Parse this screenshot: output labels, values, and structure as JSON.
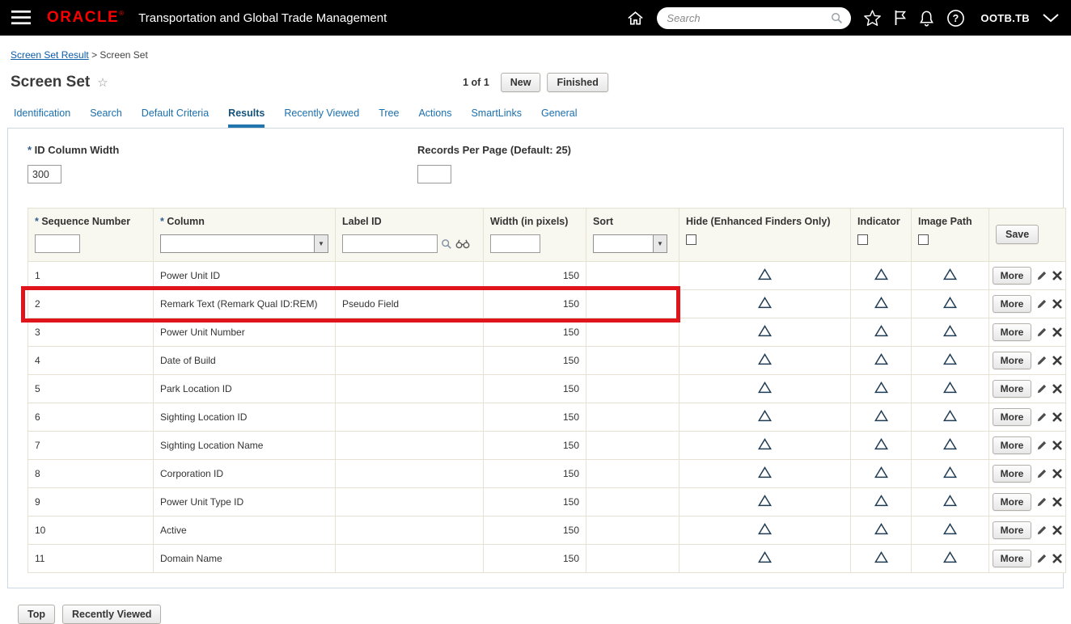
{
  "header": {
    "brand": "ORACLE",
    "brand_reg": "®",
    "app_title": "Transportation and Global Trade Management",
    "search_placeholder": "Search",
    "username": "OOTB.TB"
  },
  "breadcrumb": {
    "link": "Screen Set Result",
    "separator": ">",
    "current": "Screen Set"
  },
  "page": {
    "title": "Screen Set",
    "pager": "1 of 1",
    "new_button": "New",
    "finished_button": "Finished"
  },
  "tabs": [
    {
      "label": "Identification",
      "active": false
    },
    {
      "label": "Search",
      "active": false
    },
    {
      "label": "Default Criteria",
      "active": false
    },
    {
      "label": "Results",
      "active": true
    },
    {
      "label": "Recently Viewed",
      "active": false
    },
    {
      "label": "Tree",
      "active": false
    },
    {
      "label": "Actions",
      "active": false
    },
    {
      "label": "SmartLinks",
      "active": false
    },
    {
      "label": "General",
      "active": false
    }
  ],
  "form": {
    "id_column_width_label": "ID Column Width",
    "id_column_width_value": "300",
    "records_per_page_label": "Records Per Page (Default: 25)",
    "records_per_page_value": ""
  },
  "results_table": {
    "headers": {
      "sequence_number": "Sequence Number",
      "column": "Column",
      "label_id": "Label ID",
      "width": "Width (in pixels)",
      "sort": "Sort",
      "hide": "Hide (Enhanced Finders Only)",
      "indicator": "Indicator",
      "image_path": "Image Path"
    },
    "save_button": "Save",
    "more_button": "More",
    "rows": [
      {
        "seq": "1",
        "column": "Power Unit ID",
        "label_id": "",
        "width": "150",
        "sort": "",
        "highlighted": false
      },
      {
        "seq": "2",
        "column": "Remark Text (Remark Qual ID:REM)",
        "label_id": "Pseudo Field",
        "width": "150",
        "sort": "",
        "highlighted": true
      },
      {
        "seq": "3",
        "column": "Power Unit Number",
        "label_id": "",
        "width": "150",
        "sort": "",
        "highlighted": false
      },
      {
        "seq": "4",
        "column": "Date of Build",
        "label_id": "",
        "width": "150",
        "sort": "",
        "highlighted": false
      },
      {
        "seq": "5",
        "column": "Park Location ID",
        "label_id": "",
        "width": "150",
        "sort": "",
        "highlighted": false
      },
      {
        "seq": "6",
        "column": "Sighting Location ID",
        "label_id": "",
        "width": "150",
        "sort": "",
        "highlighted": false
      },
      {
        "seq": "7",
        "column": "Sighting Location Name",
        "label_id": "",
        "width": "150",
        "sort": "",
        "highlighted": false
      },
      {
        "seq": "8",
        "column": "Corporation ID",
        "label_id": "",
        "width": "150",
        "sort": "",
        "highlighted": false
      },
      {
        "seq": "9",
        "column": "Power Unit Type ID",
        "label_id": "",
        "width": "150",
        "sort": "",
        "highlighted": false
      },
      {
        "seq": "10",
        "column": "Active",
        "label_id": "",
        "width": "150",
        "sort": "",
        "highlighted": false
      },
      {
        "seq": "11",
        "column": "Domain Name",
        "label_id": "",
        "width": "150",
        "sort": "",
        "highlighted": false
      }
    ]
  },
  "footer": {
    "top_button": "Top",
    "recently_viewed_button": "Recently Viewed"
  },
  "icons": {
    "menu-icon": "hamburger bars",
    "home-icon": "house outline",
    "search-icon": "magnifier",
    "favorites-icon": "star outline",
    "flag-icon": "flag outline",
    "notifications-icon": "bell outline",
    "help-icon": "question circle",
    "chevron-down-icon": "chevron",
    "binoculars-icon": "finder",
    "sort-triangle-icon": "△",
    "edit-pencil-icon": "pencil",
    "delete-x-icon": "✖",
    "dropdown-arrow": "▼"
  },
  "colors": {
    "brand_red": "#f80000",
    "link_blue": "#0b5cab",
    "tab_blue": "#1a6fae",
    "highlight_border": "#e0151c",
    "header_bg": "#000000",
    "table_header_bg": "#f9f8f0"
  }
}
